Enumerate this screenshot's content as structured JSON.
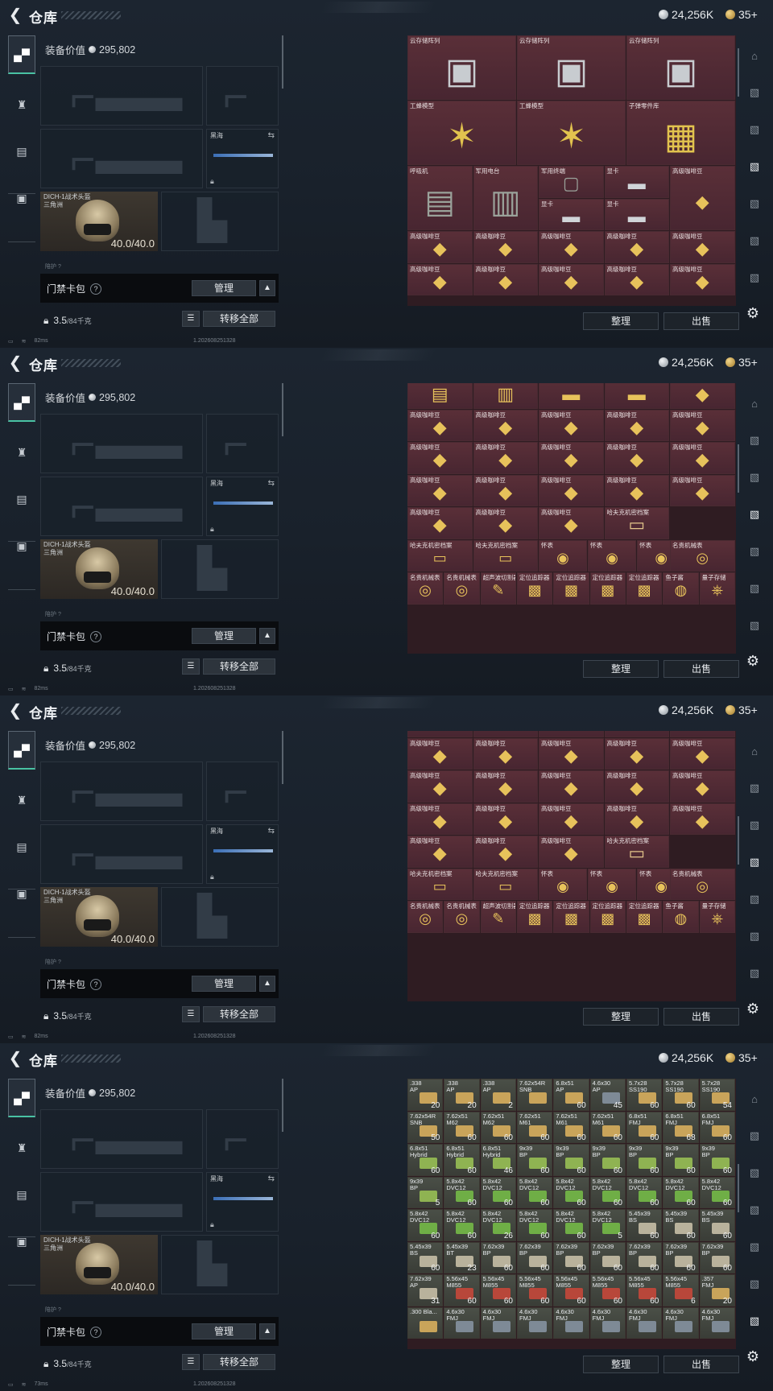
{
  "header": {
    "title": "仓库",
    "silver": "24,256K",
    "gold": "35+"
  },
  "equipment": {
    "value_label": "装备价值",
    "value": "295,802",
    "melee_name": "黑海",
    "helmet_name": "DICH-1战术头盔",
    "helmet_sub": "三角洲",
    "helmet_durability": "40.0/40.0",
    "pouch_label": "陪护 ?",
    "card_label": "门禁卡包",
    "card_help": "?",
    "manage_label": "管理",
    "weight_value": "3.5",
    "weight_max": "/84千克",
    "transfer_label": "转移全部"
  },
  "stash": {
    "sort_label": "整理",
    "sell_label": "出售"
  },
  "status": {
    "ping_1": "82ms",
    "ping_4": "73ms",
    "build": "1.202608251328"
  },
  "panel1": {
    "rows": [
      {
        "names": [
          "云存储阵列",
          "云存储阵列",
          "云存储阵列"
        ]
      },
      {
        "names": [
          "工蜂模型",
          "工蜂模型",
          "子弹零件库"
        ]
      },
      {
        "names": [
          "呼吸机",
          "军用电台",
          "军用终端",
          "显卡",
          "高级咖啡豆"
        ]
      },
      {
        "names": [
          "显卡",
          "显卡"
        ]
      },
      {
        "names": [
          "高级咖啡豆",
          "高级咖啡豆",
          "高级咖啡豆",
          "高级咖啡豆",
          "高级咖啡豆"
        ]
      },
      {
        "names": [
          "高级咖啡豆",
          "高级咖啡豆",
          "高级咖啡豆",
          "高级咖啡豆",
          "高级咖啡豆"
        ]
      }
    ]
  },
  "panel2": {
    "rows": [
      {
        "names": [
          "高级咖啡豆",
          "高级咖啡豆",
          "高级咖啡豆",
          "高级咖啡豆",
          "高级咖啡豆"
        ]
      },
      {
        "names": [
          "高级咖啡豆",
          "高级咖啡豆",
          "高级咖啡豆",
          "高级咖啡豆",
          "高级咖啡豆"
        ]
      },
      {
        "names": [
          "高级咖啡豆",
          "高级咖啡豆",
          "高级咖啡豆",
          "高级咖啡豆",
          "高级咖啡豆"
        ]
      },
      {
        "names": [
          "高级咖啡豆",
          "高级咖啡豆",
          "高级咖啡豆",
          "哈夫克机密档案"
        ]
      },
      {
        "names": [
          "哈夫克机密档案",
          "哈夫克机密档案",
          "怀表",
          "怀表",
          "怀表",
          "怀表",
          "名贵机械表"
        ]
      },
      {
        "names": [
          "名贵机械表",
          "名贵机械表",
          "超声波切割器",
          "定位追踪器",
          "定位追踪器",
          "定位追踪器",
          "定位追踪器",
          "鱼子酱",
          "量子存储"
        ]
      }
    ]
  },
  "panel4": {
    "rows": [
      [
        [
          ".338\nAP",
          "20"
        ],
        [
          ".338\nAP",
          "20"
        ],
        [
          ".338\nAP",
          "2"
        ],
        [
          "7.62x54R\nSNB",
          ""
        ],
        [
          "6.8x51\nAP",
          "60"
        ],
        [
          "4.6x30\nAP",
          "45"
        ],
        [
          "5.7x28\nSS190",
          "60"
        ],
        [
          "5.7x28\nSS190",
          "60"
        ],
        [
          "5.7x28\nSS190",
          "54"
        ]
      ],
      [
        [
          "7.62x54R\nSNB",
          "50"
        ],
        [
          "7.62x51\nM62",
          "60"
        ],
        [
          "7.62x51\nM62",
          "60"
        ],
        [
          "7.62x51\nM61",
          "60"
        ],
        [
          "7.62x51\nM61",
          "60"
        ],
        [
          "7.62x51\nM61",
          "60"
        ],
        [
          "6.8x51\nFMJ",
          "60"
        ],
        [
          "6.8x51\nFMJ",
          "68"
        ],
        [
          "6.8x51\nFMJ",
          "60"
        ]
      ],
      [
        [
          "6.8x51\nHybrid",
          "60"
        ],
        [
          "6.8x51\nHybrid",
          "60"
        ],
        [
          "6.8x51\nHybrid",
          "46"
        ],
        [
          "9x39\nBP",
          "60"
        ],
        [
          "9x39\nBP",
          "60"
        ],
        [
          "9x39\nBP",
          "60"
        ],
        [
          "9x39\nBP",
          "60"
        ],
        [
          "9x39\nBP",
          "60"
        ],
        [
          "9x39\nBP",
          "60"
        ]
      ],
      [
        [
          "9x39\nBP",
          "5"
        ],
        [
          "5.8x42\nDVC12",
          "60"
        ],
        [
          "5.8x42\nDVC12",
          "60"
        ],
        [
          "5.8x42\nDVC12",
          "60"
        ],
        [
          "5.8x42\nDVC12",
          "60"
        ],
        [
          "5.8x42\nDVC12",
          "60"
        ],
        [
          "5.8x42\nDVC12",
          "60"
        ],
        [
          "5.8x42\nDVC12",
          "60"
        ],
        [
          "5.8x42\nDVC12",
          "60"
        ]
      ],
      [
        [
          "5.8x42\nDVC12",
          "60"
        ],
        [
          "5.8x42\nDVC12",
          "60"
        ],
        [
          "5.8x42\nDVC12",
          "26"
        ],
        [
          "5.8x42\nDVC12",
          "60"
        ],
        [
          "5.8x42\nDVC12",
          "60"
        ],
        [
          "5.8x42\nDVC12",
          "5"
        ],
        [
          "5.45x39\nBS",
          "60"
        ],
        [
          "5.45x39\nBS",
          "60"
        ],
        [
          "5.45x39\nBS",
          "60"
        ]
      ],
      [
        [
          "5.45x39\nBS",
          "60"
        ],
        [
          "5.45x39\nBT",
          "23"
        ],
        [
          "7.62x39\nBP",
          "60"
        ],
        [
          "7.62x39\nBP",
          "60"
        ],
        [
          "7.62x39\nBP",
          "60"
        ],
        [
          "7.62x39\nBP",
          "60"
        ],
        [
          "7.62x39\nBP",
          "60"
        ],
        [
          "7.62x39\nBP",
          "60"
        ],
        [
          "7.62x39\nBP",
          "60"
        ]
      ],
      [
        [
          "7.62x39\nAP",
          "31"
        ],
        [
          "5.56x45\nM855",
          "60"
        ],
        [
          "5.56x45\nM855",
          "60"
        ],
        [
          "5.56x45\nM855",
          "60"
        ],
        [
          "5.56x45\nM855",
          "60"
        ],
        [
          "5.56x45\nM855",
          "60"
        ],
        [
          "5.56x45\nM855",
          "60"
        ],
        [
          "5.56x45\nM855",
          "6"
        ],
        [
          ".357\nFMJ",
          "20"
        ]
      ],
      [
        [
          ".300 Bla...",
          ""
        ],
        [
          "4.6x30\nFMJ",
          ""
        ],
        [
          "4.6x30\nFMJ",
          ""
        ],
        [
          "4.6x30\nFMJ",
          ""
        ],
        [
          "4.6x30\nFMJ",
          ""
        ],
        [
          "4.6x30\nFMJ",
          ""
        ],
        [
          "4.6x30\nFMJ",
          ""
        ],
        [
          "4.6x30\nFMJ",
          ""
        ],
        [
          "4.6x30\nFMJ",
          ""
        ]
      ]
    ]
  },
  "colors": {
    "accent": "#49c2a3",
    "stash_bg": "#482631",
    "ammo_green": "#7fbf4a",
    "ammo_red": "#c04a3a",
    "ammo_brass": "#c9a45a"
  }
}
